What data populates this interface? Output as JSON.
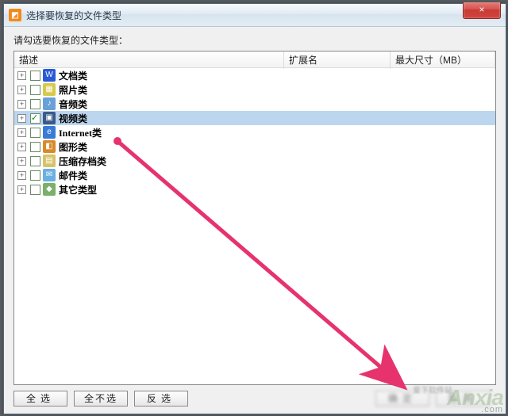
{
  "titlebar": {
    "title": "选择要恢复的文件类型",
    "close_glyph": "×"
  },
  "instruction": "请勾选要恢复的文件类型：",
  "columns": {
    "desc": "描述",
    "ext": "扩展名",
    "size": "最大尺寸（MB）"
  },
  "rows": [
    {
      "label": "文档类",
      "checked": false,
      "icon_bg": "#2a5bd7",
      "icon_glyph": "W"
    },
    {
      "label": "照片类",
      "checked": false,
      "icon_bg": "#d7c94a",
      "icon_glyph": "▦"
    },
    {
      "label": "音频类",
      "checked": false,
      "icon_bg": "#6aa0d7",
      "icon_glyph": "♪"
    },
    {
      "label": "视频类",
      "checked": true,
      "icon_bg": "#3a5a8a",
      "icon_glyph": "▣",
      "selected": true
    },
    {
      "label": "Internet类",
      "checked": false,
      "icon_bg": "#3a7ad7",
      "icon_glyph": "e"
    },
    {
      "label": "图形类",
      "checked": false,
      "icon_bg": "#d78a2a",
      "icon_glyph": "◧"
    },
    {
      "label": "压缩存档类",
      "checked": false,
      "icon_bg": "#d7c36a",
      "icon_glyph": "▤"
    },
    {
      "label": "邮件类",
      "checked": false,
      "icon_bg": "#6ab0e0",
      "icon_glyph": "✉"
    },
    {
      "label": "其它类型",
      "checked": false,
      "icon_bg": "#7ab06a",
      "icon_glyph": "◆"
    }
  ],
  "buttons": {
    "select_all": "全选",
    "select_none": "全不选",
    "invert": "反选",
    "ok": "确定",
    "cancel": "取消"
  },
  "watermark": {
    "main": "Anxia",
    "sub": ".com"
  },
  "footer_faint": "爱下软件站"
}
